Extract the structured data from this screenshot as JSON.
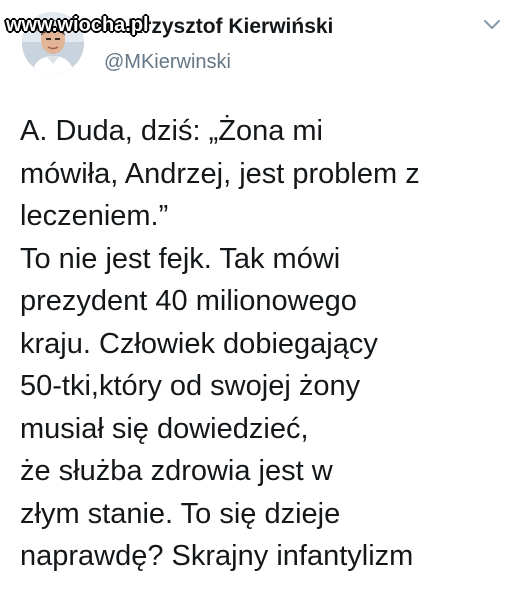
{
  "watermark": "www.wiocha.pl",
  "author": {
    "name": "Krzysztof Kierwiński",
    "handle": "@MKierwinski"
  },
  "tweet": {
    "lines": [
      "A. Duda, dziś: „Żona mi",
      "mówiła, Andrzej, jest problem z",
      "leczeniem.”",
      "To nie jest fejk. Tak mówi",
      "prezydent 40 milionowego",
      "kraju. Człowiek dobiegający",
      "50-tki,który od swojej żony",
      "musiał się dowiedzieć,",
      "że służba zdrowia jest w",
      "złym stanie. To się dzieje",
      "naprawdę? Skrajny infantylizm"
    ]
  },
  "icons": {
    "avatar": "profile-photo",
    "menu": "chevron-down-icon"
  },
  "colors": {
    "text": "#14171a",
    "secondary": "#657786",
    "background": "#ffffff"
  }
}
